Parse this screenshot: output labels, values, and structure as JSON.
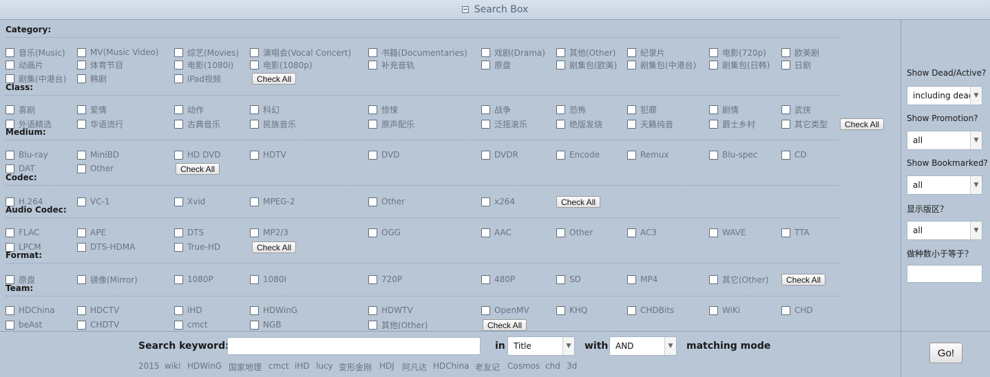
{
  "header": {
    "title": "Search Box"
  },
  "sections": {
    "category": {
      "title": "Category:",
      "items": [
        "音乐(Music)",
        "MV(Music Video)",
        "综艺(Movies)",
        "演唱会(Vocal Concert)",
        "书籍(Documentaries)",
        "戏剧(Drama)",
        "其他(Other)",
        "纪录片",
        "电影(720p)",
        "欧美剧",
        "动画片",
        "体育节目",
        "电影(1080i)",
        "电影(1080p)",
        "补充音轨",
        "原盘",
        "剧集包(欧美)",
        "剧集包(中港台)",
        "剧集包(日韩)",
        "日剧",
        "剧集(中港台)",
        "韩剧",
        "iPad视频"
      ],
      "check_all": "Check All"
    },
    "class": {
      "title": "Class:",
      "items": [
        "喜剧",
        "爱情",
        "动作",
        "科幻",
        "惊悚",
        "战争",
        "恐怖",
        "犯罪",
        "剧情",
        "武侠",
        "外语精选",
        "华语流行",
        "古典音乐",
        "民族音乐",
        "原声配乐",
        "泛摇滚乐",
        "绝版发烧",
        "天籁纯音",
        "爵士乡村",
        "其它类型"
      ],
      "check_all": "Check All"
    },
    "medium": {
      "title": "Medium:",
      "items": [
        "Blu-ray",
        "MiniBD",
        "HD DVD",
        "HDTV",
        "DVD",
        "DVDR",
        "Encode",
        "Remux",
        "Blu-spec",
        "CD",
        "DAT",
        "Other"
      ],
      "check_all": "Check All"
    },
    "codec": {
      "title": "Codec:",
      "items": [
        "H.264",
        "VC-1",
        "Xvid",
        "MPEG-2",
        "Other",
        "x264"
      ],
      "check_all": "Check All"
    },
    "audio_codec": {
      "title": "Audio Codec:",
      "items": [
        "FLAC",
        "APE",
        "DTS",
        "MP2/3",
        "OGG",
        "AAC",
        "Other",
        "AC3",
        "WAVE",
        "TTA",
        "LPCM",
        "DTS-HDMA",
        "True-HD"
      ],
      "check_all": "Check All"
    },
    "format": {
      "title": "Format:",
      "items": [
        "原盘",
        "镜像(Mirror)",
        "1080P",
        "1080I",
        "720P",
        "480P",
        "SD",
        "MP4",
        "其它(Other)"
      ],
      "check_all": "Check All"
    },
    "team": {
      "title": "Team:",
      "items": [
        "HDChina",
        "HDCTV",
        "iHD",
        "HDWinG",
        "HDWTV",
        "OpenMV",
        "KHQ",
        "CHDBits",
        "WiKi",
        "CHD",
        "beAst",
        "CHDTV",
        "cmct",
        "NGB",
        "其他(Other)"
      ],
      "check_all": "Check All"
    }
  },
  "sidebar": {
    "dead_active": {
      "label": "Show Dead/Active?",
      "value": "including dead"
    },
    "promotion": {
      "label": "Show Promotion?",
      "value": "all"
    },
    "bookmarked": {
      "label": "Show Bookmarked?",
      "value": "all"
    },
    "zone": {
      "label": "显示版区？",
      "value": "all"
    },
    "seeds": {
      "label": "做种数小于等于？",
      "value": ""
    }
  },
  "search": {
    "keyword_label": "Search keyword:",
    "keyword_value": "",
    "in_label": "in",
    "in_value": "Title",
    "with_label": "with",
    "with_value": "AND",
    "mode_label": "matching mode",
    "go_label": "Go!",
    "hot_keywords": [
      "2015",
      "wiki",
      "HDWinG",
      "国家地理",
      "cmct",
      "iHD",
      "lucy",
      "变形金刚",
      "HDJ",
      "阿凡达",
      "HDChina",
      "老友记",
      "Cosmos",
      "chd",
      "3d"
    ]
  }
}
